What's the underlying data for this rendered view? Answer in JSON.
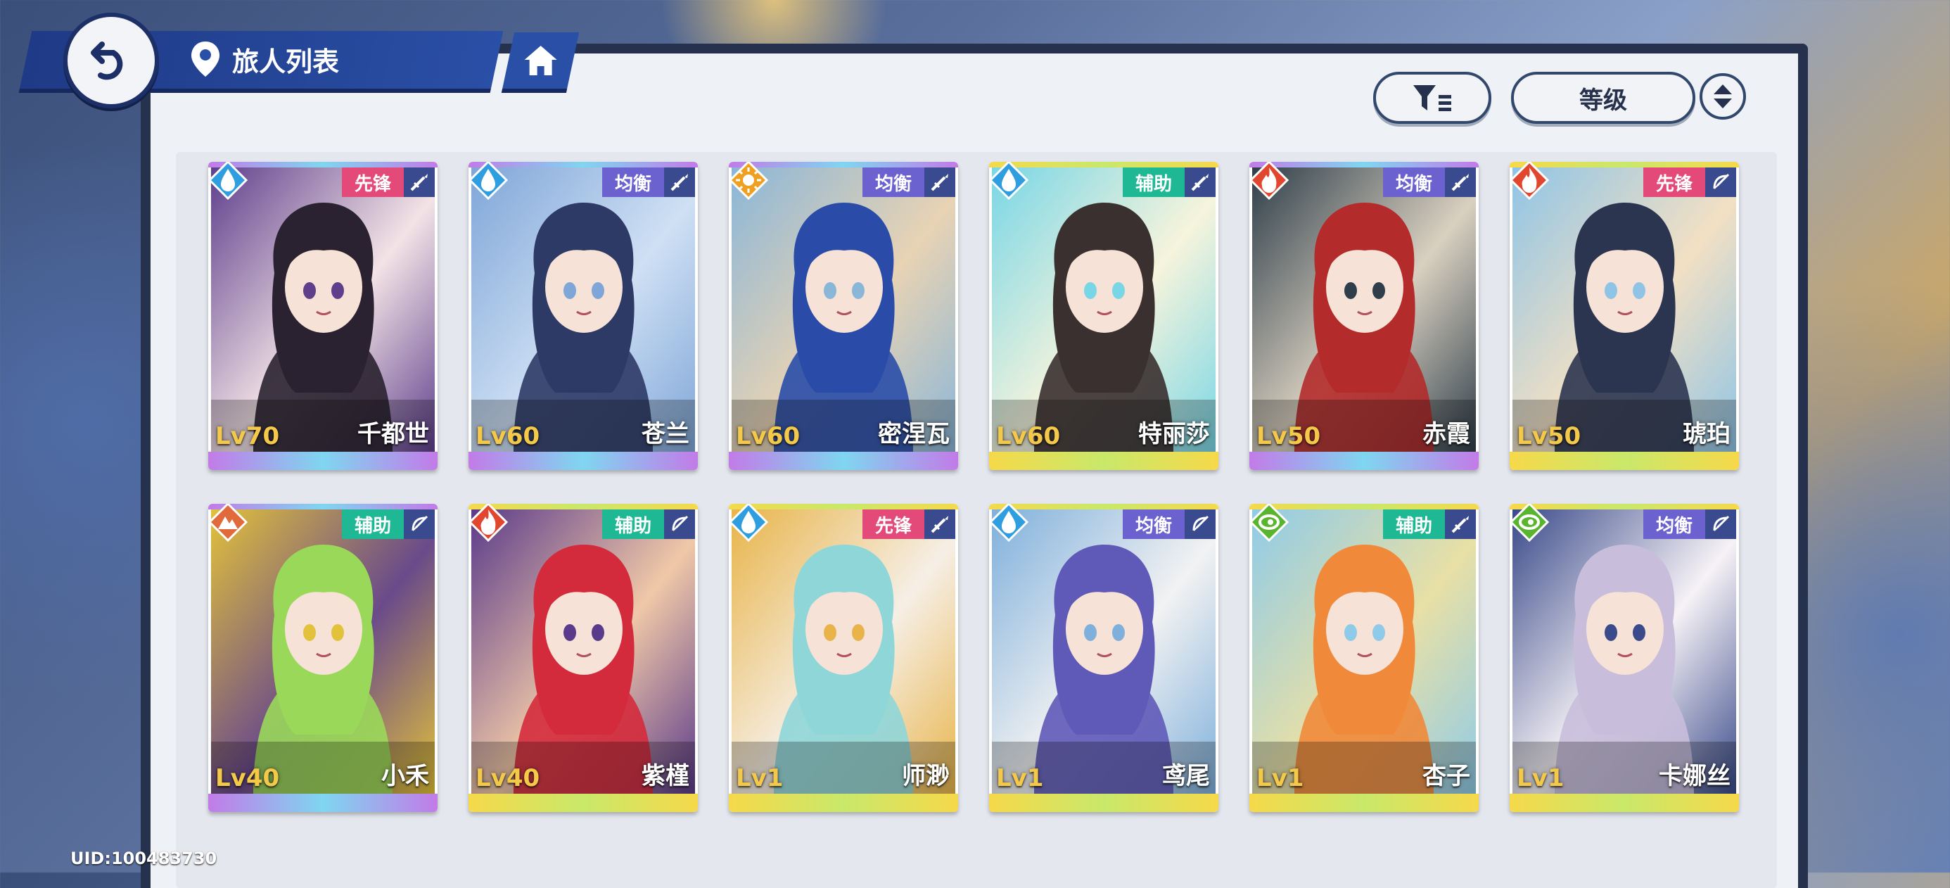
{
  "header": {
    "title": "旅人列表"
  },
  "toolbar": {
    "sort_label": "等级"
  },
  "uid": "UID:100483730",
  "colors": {
    "water": "#2f9ee0",
    "light": "#f0a020",
    "fire": "#e0472e",
    "earth": "#e06a3a",
    "wind": "#5ab52e",
    "role_vanguard": "#e34a7a",
    "role_balance": "#6b62d0",
    "role_support": "#1fb894"
  },
  "cards": [
    {
      "level": "Lv70",
      "name": "千都世",
      "role": "先锋",
      "element": "water-icon",
      "weapon": "sword-icon",
      "rarity": "purple",
      "art": [
        "#2a2230",
        "#5e3f8c",
        "#f3e3e6"
      ]
    },
    {
      "level": "Lv60",
      "name": "苍兰",
      "role": "均衡",
      "element": "water-icon",
      "weapon": "sword-icon",
      "rarity": "purple",
      "art": [
        "#2e3a66",
        "#7fa6d8",
        "#cfe0f4"
      ]
    },
    {
      "level": "Lv60",
      "name": "密涅瓦",
      "role": "均衡",
      "element": "light-icon",
      "weapon": "sword-icon",
      "rarity": "purple",
      "art": [
        "#2a4ca8",
        "#8ab6d8",
        "#e8d3b4"
      ]
    },
    {
      "level": "Lv60",
      "name": "特丽莎",
      "role": "辅助",
      "element": "water-icon",
      "weapon": "sword-icon",
      "rarity": "gold",
      "art": [
        "#3a3030",
        "#79d6e6",
        "#f6f4dc"
      ]
    },
    {
      "level": "Lv50",
      "name": "赤霞",
      "role": "均衡",
      "element": "fire-icon",
      "weapon": "sword-icon",
      "rarity": "purple",
      "art": [
        "#b32b2b",
        "#2e3e4a",
        "#d9d0c0"
      ]
    },
    {
      "level": "Lv50",
      "name": "琥珀",
      "role": "先锋",
      "element": "fire-icon",
      "weapon": "bow-icon",
      "rarity": "gold",
      "art": [
        "#2c3550",
        "#8fc4e6",
        "#f2e0c4"
      ]
    },
    {
      "level": "Lv40",
      "name": "小禾",
      "role": "辅助",
      "element": "earth-icon",
      "weapon": "bow-icon",
      "rarity": "purple",
      "art": [
        "#9ad85a",
        "#e2c23a",
        "#6a4a8a"
      ]
    },
    {
      "level": "Lv40",
      "name": "紫槿",
      "role": "辅助",
      "element": "fire-icon",
      "weapon": "bow-icon",
      "rarity": "gold",
      "art": [
        "#d42b3c",
        "#5a3a8a",
        "#f0c8a8"
      ]
    },
    {
      "level": "Lv1",
      "name": "师渺",
      "role": "先锋",
      "element": "water-icon",
      "weapon": "sword-icon",
      "rarity": "gold",
      "art": [
        "#8fd6d8",
        "#e8b44a",
        "#f6efe6"
      ]
    },
    {
      "level": "Lv1",
      "name": "鸢尾",
      "role": "均衡",
      "element": "water-icon",
      "weapon": "bow-icon",
      "rarity": "gold",
      "art": [
        "#5f5ab8",
        "#7fb0dc",
        "#f2f2f2"
      ]
    },
    {
      "level": "Lv1",
      "name": "杏子",
      "role": "辅助",
      "element": "wind-icon",
      "weapon": "sword-icon",
      "rarity": "gold",
      "art": [
        "#f08a3a",
        "#8fcbe8",
        "#e8e0a6"
      ]
    },
    {
      "level": "Lv1",
      "name": "卡娜丝",
      "role": "均衡",
      "element": "wind-icon",
      "weapon": "bow-icon",
      "rarity": "gold",
      "art": [
        "#c8bedc",
        "#3a4a8a",
        "#f6f2f6"
      ]
    }
  ]
}
